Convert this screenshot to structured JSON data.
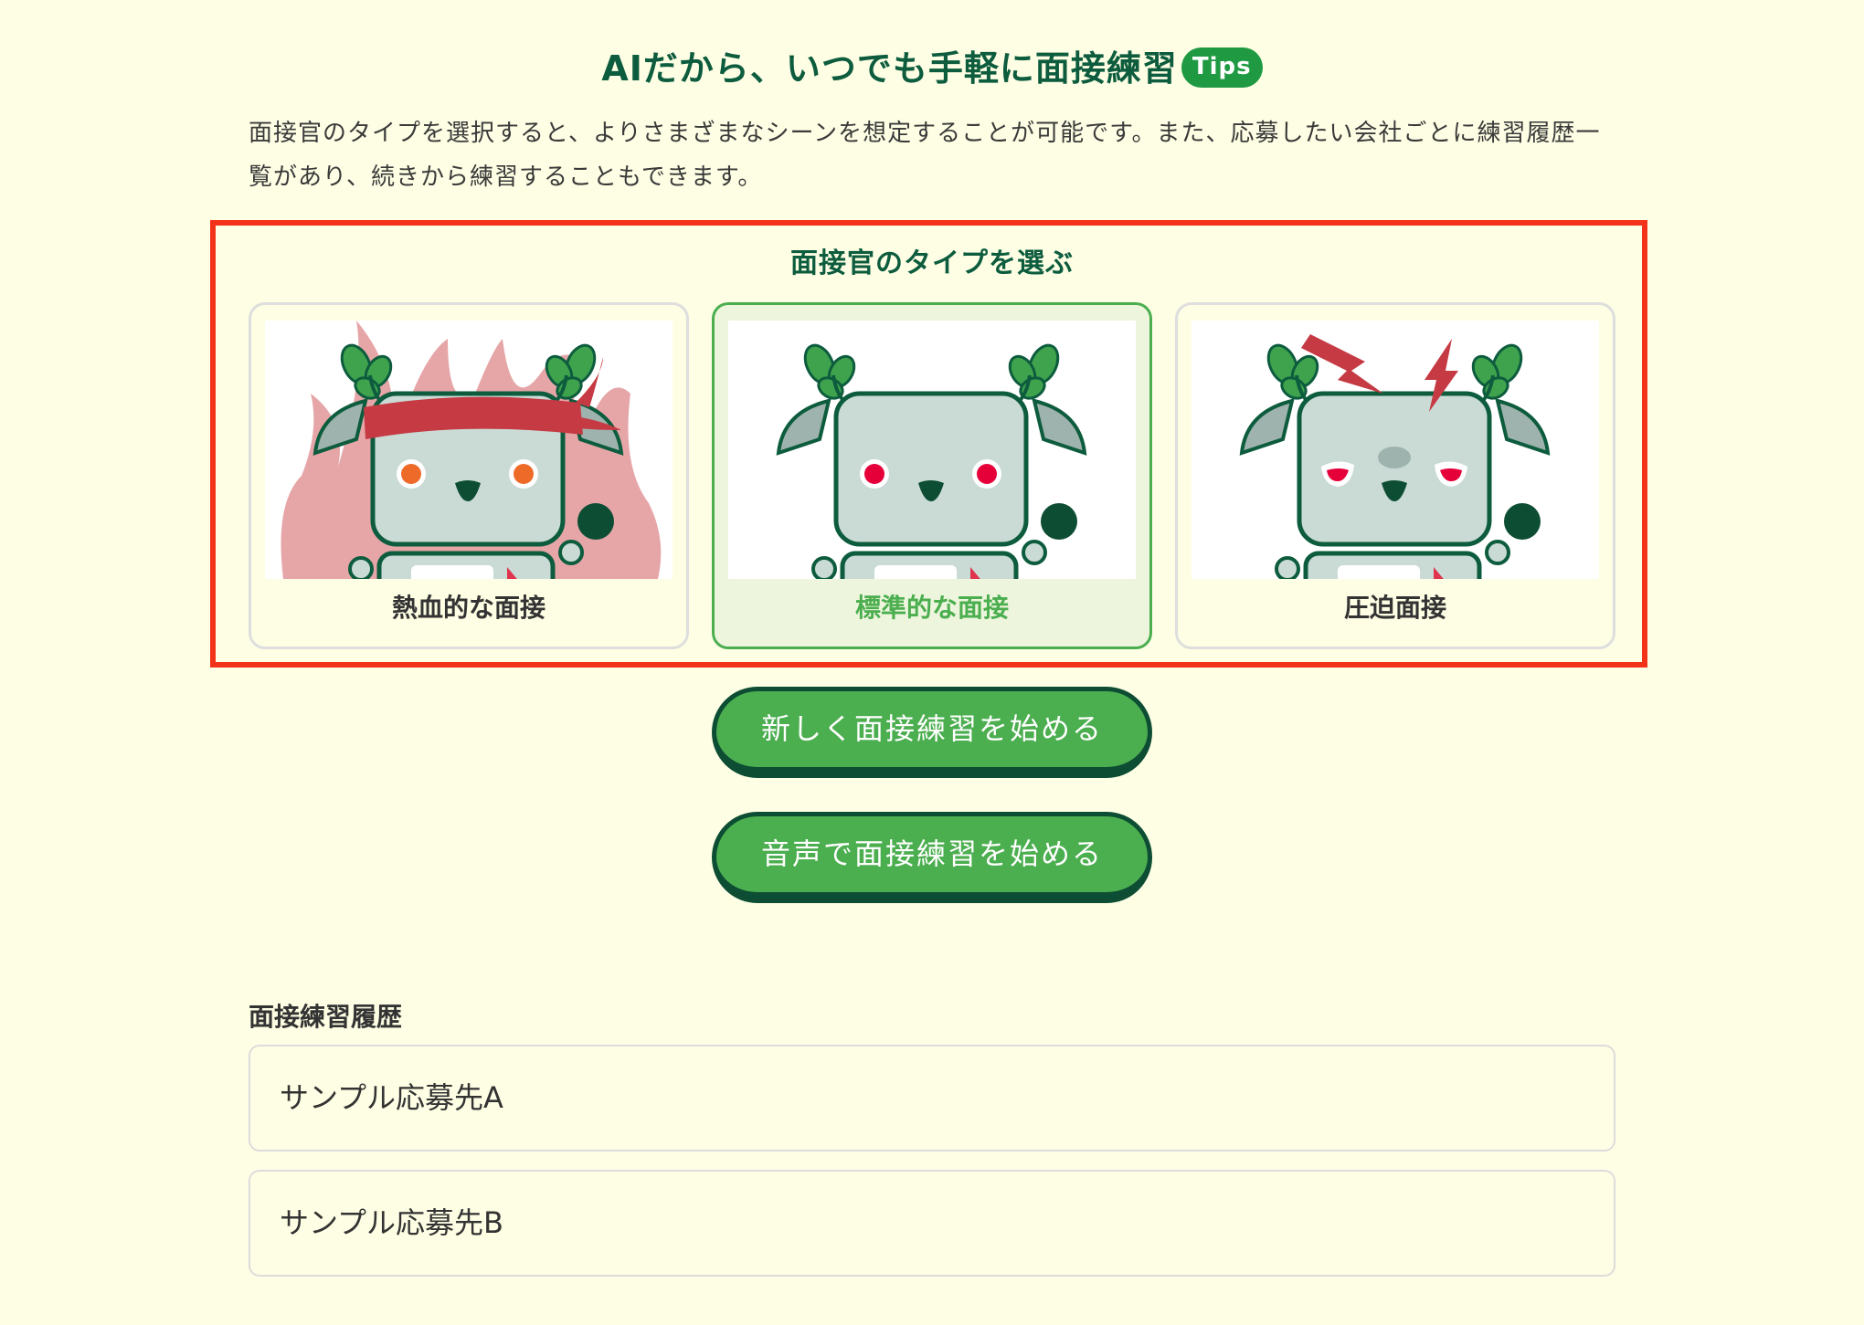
{
  "header": {
    "title": "AIだから、いつでも手軽に面接練習",
    "badge": "Tips"
  },
  "description": "面接官のタイプを選択すると、よりさまざまなシーンを想定することが可能です。また、応募したい会社ごとに練習履歴一覧があり、続きから練習することもできます。",
  "interviewer_select": {
    "heading": "面接官のタイプを選ぶ",
    "options": [
      {
        "label": "熱血的な面接",
        "icon": "passionate-robot-illustration",
        "selected": false
      },
      {
        "label": "標準的な面接",
        "icon": "standard-robot-illustration",
        "selected": true
      },
      {
        "label": "圧迫面接",
        "icon": "pressure-robot-illustration",
        "selected": false
      }
    ]
  },
  "actions": {
    "start_new_label": "新しく面接練習を始める",
    "start_voice_label": "音声で面接練習を始める"
  },
  "history": {
    "heading": "面接練習履歴",
    "items": [
      "サンプル応募先A",
      "サンプル応募先B"
    ]
  },
  "colors": {
    "background": "#fefee4",
    "primary_green": "#4bae4f",
    "dark_green": "#0d5c3e",
    "highlight_red": "#f23219"
  }
}
